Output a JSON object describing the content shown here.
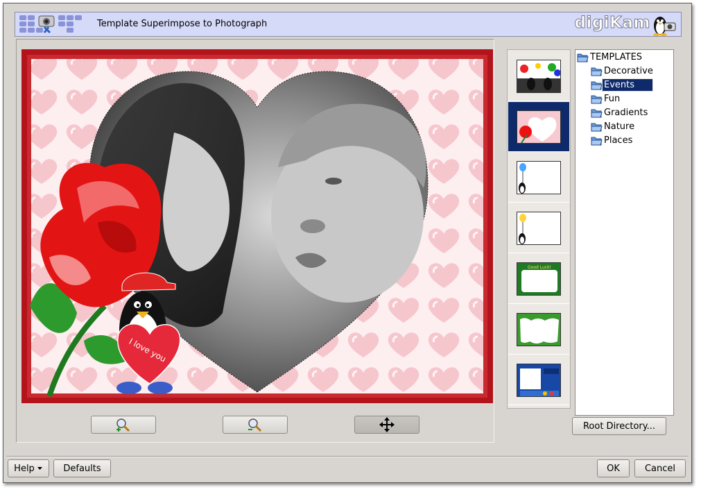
{
  "header": {
    "title": "Template Superimpose to Photograph",
    "brand": "digiKam",
    "logo_icon": "plugin-logo-icon",
    "mascot_icon": "tux-camera-icon"
  },
  "preview": {
    "overlay_text": "I love you",
    "tools": [
      {
        "name": "zoom-in-button",
        "icon": "zoom-in-icon"
      },
      {
        "name": "zoom-out-button",
        "icon": "zoom-out-icon"
      },
      {
        "name": "move-button",
        "icon": "move-icon",
        "active": true
      }
    ]
  },
  "templates": {
    "thumbnails": [
      {
        "name": "template-thumb-party"
      },
      {
        "name": "template-thumb-rose-heart",
        "selected": true
      },
      {
        "name": "template-thumb-balloon-blue"
      },
      {
        "name": "template-thumb-balloon-yellow"
      },
      {
        "name": "template-thumb-good-luck",
        "caption": "Good Luck!"
      },
      {
        "name": "template-thumb-leaves"
      },
      {
        "name": "template-thumb-blue-frame"
      }
    ],
    "tree": {
      "root": "TEMPLATES",
      "items": [
        "Decorative",
        "Events",
        "Fun",
        "Gradients",
        "Nature",
        "Places"
      ],
      "selected": "Events"
    },
    "root_directory_label": "Root Directory..."
  },
  "footer": {
    "help_label": "Help",
    "defaults_label": "Defaults",
    "ok_label": "OK",
    "cancel_label": "Cancel"
  },
  "colors": {
    "accent": "#0e2a6b",
    "banner": "#d5daf8",
    "frame_red": "#b80f16",
    "heart_pink": "#f6c9cf"
  }
}
